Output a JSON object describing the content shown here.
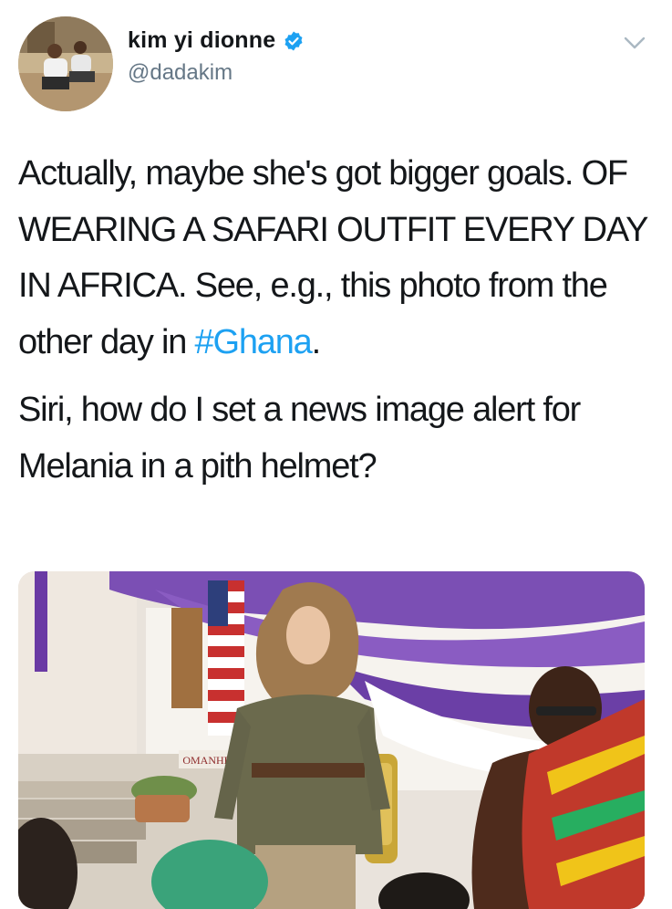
{
  "user": {
    "display_name": "kim yi dionne",
    "handle": "@dadakim",
    "verified": true,
    "avatar_icon": "profile-photo"
  },
  "tweet": {
    "paragraph1": "Actually, maybe she's got bigger goals. OF WEARING A SAFARI OUTFIT EVERY DAY IN AFRICA. See, e.g., this photo from the other day in ",
    "hashtag": "#Ghana",
    "paragraph1_end": ".",
    "paragraph2": "Siri, how do I set a news image alert for Melania in a pith helmet?"
  },
  "media": {
    "sign_text": "OMANHEN"
  },
  "colors": {
    "link": "#1da1f2",
    "verified": "#1da1f2",
    "secondary_text": "#657786"
  },
  "icons": [
    "verified-badge-icon",
    "chevron-down-icon"
  ]
}
